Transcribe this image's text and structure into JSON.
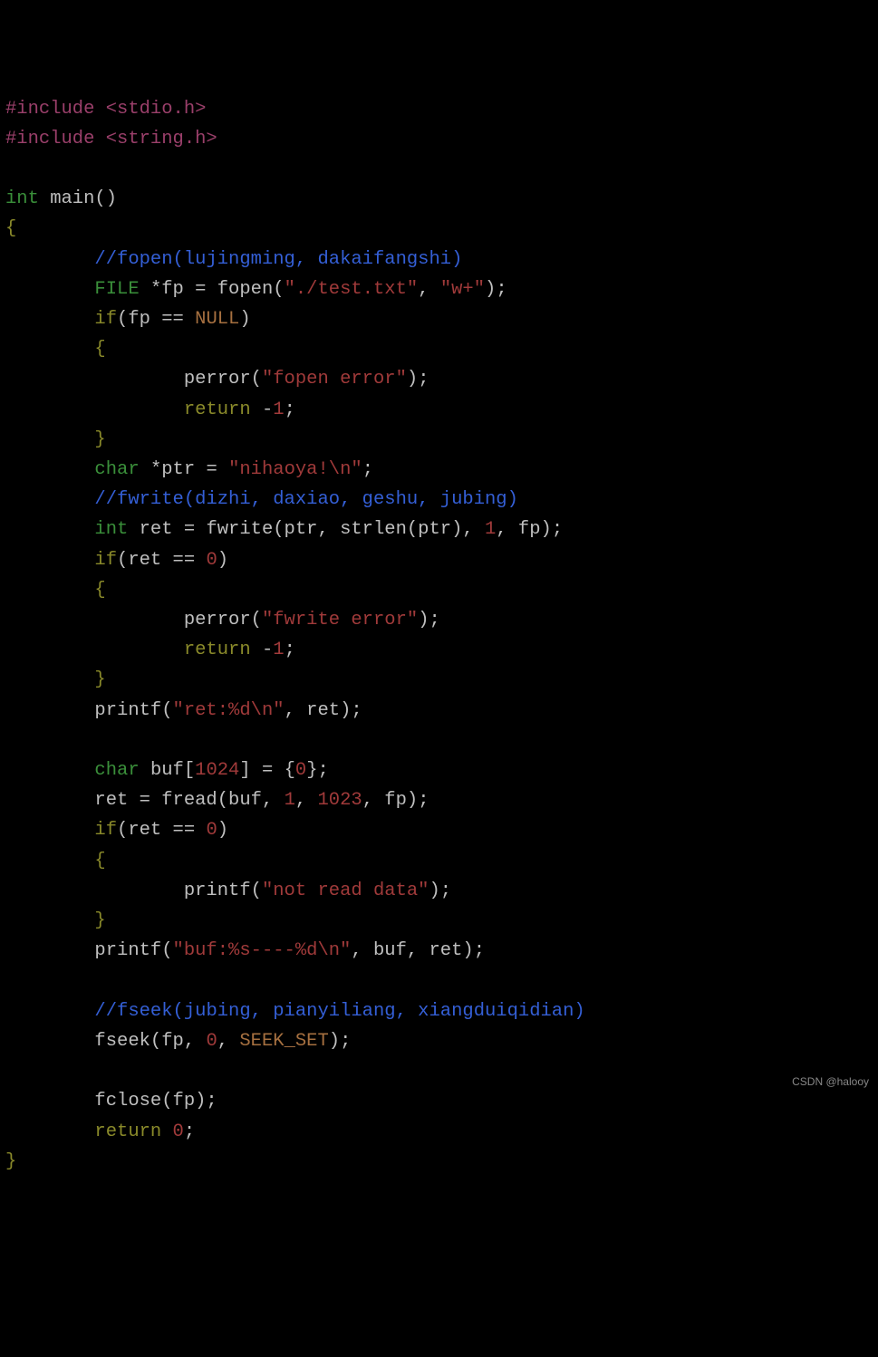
{
  "tokens": [
    [
      "pp",
      "#include "
    ],
    [
      "hdr",
      "<stdio.h>"
    ],
    [
      "nl",
      ""
    ],
    [
      "pp",
      "#include "
    ],
    [
      "hdr",
      "<string.h>"
    ],
    [
      "nl",
      ""
    ],
    [
      "nl",
      ""
    ],
    [
      "typ",
      "int"
    ],
    [
      "id",
      " main"
    ],
    [
      "op",
      "()"
    ],
    [
      "nl",
      ""
    ],
    [
      "br",
      "{"
    ],
    [
      "nl",
      ""
    ],
    [
      "id",
      "        "
    ],
    [
      "cmt",
      "//fopen(lujingming, dakaifangshi)"
    ],
    [
      "nl",
      ""
    ],
    [
      "id",
      "        "
    ],
    [
      "typ",
      "FILE"
    ],
    [
      "id",
      " *fp = fopen("
    ],
    [
      "str",
      "\"./test.txt\""
    ],
    [
      "id",
      ", "
    ],
    [
      "str",
      "\"w+\""
    ],
    [
      "id",
      ");"
    ],
    [
      "nl",
      ""
    ],
    [
      "id",
      "        "
    ],
    [
      "kw",
      "if"
    ],
    [
      "id",
      "(fp == "
    ],
    [
      "mac",
      "NULL"
    ],
    [
      "id",
      ")"
    ],
    [
      "nl",
      ""
    ],
    [
      "id",
      "        "
    ],
    [
      "br",
      "{"
    ],
    [
      "nl",
      ""
    ],
    [
      "id",
      "                perror("
    ],
    [
      "str",
      "\"fopen error\""
    ],
    [
      "id",
      ");"
    ],
    [
      "nl",
      ""
    ],
    [
      "id",
      "                "
    ],
    [
      "kw",
      "return"
    ],
    [
      "id",
      " -"
    ],
    [
      "num",
      "1"
    ],
    [
      "id",
      ";"
    ],
    [
      "nl",
      ""
    ],
    [
      "id",
      "        "
    ],
    [
      "br",
      "}"
    ],
    [
      "nl",
      ""
    ],
    [
      "id",
      "        "
    ],
    [
      "typ",
      "char"
    ],
    [
      "id",
      " *ptr = "
    ],
    [
      "str",
      "\"nihaoya!\\n\""
    ],
    [
      "id",
      ";"
    ],
    [
      "nl",
      ""
    ],
    [
      "id",
      "        "
    ],
    [
      "cmt",
      "//fwrite(dizhi, daxiao, geshu, jubing)"
    ],
    [
      "nl",
      ""
    ],
    [
      "id",
      "        "
    ],
    [
      "typ",
      "int"
    ],
    [
      "id",
      " ret = fwrite(ptr, strlen(ptr), "
    ],
    [
      "num",
      "1"
    ],
    [
      "id",
      ", fp);"
    ],
    [
      "nl",
      ""
    ],
    [
      "id",
      "        "
    ],
    [
      "kw",
      "if"
    ],
    [
      "id",
      "(ret == "
    ],
    [
      "num",
      "0"
    ],
    [
      "id",
      ")"
    ],
    [
      "nl",
      ""
    ],
    [
      "id",
      "        "
    ],
    [
      "br",
      "{"
    ],
    [
      "nl",
      ""
    ],
    [
      "id",
      "                perror("
    ],
    [
      "str",
      "\"fwrite error\""
    ],
    [
      "id",
      ");"
    ],
    [
      "nl",
      ""
    ],
    [
      "id",
      "                "
    ],
    [
      "kw",
      "return"
    ],
    [
      "id",
      " -"
    ],
    [
      "num",
      "1"
    ],
    [
      "id",
      ";"
    ],
    [
      "nl",
      ""
    ],
    [
      "id",
      "        "
    ],
    [
      "br",
      "}"
    ],
    [
      "nl",
      ""
    ],
    [
      "id",
      "        printf("
    ],
    [
      "str",
      "\"ret:%d\\n\""
    ],
    [
      "id",
      ", ret);"
    ],
    [
      "nl",
      ""
    ],
    [
      "nl",
      ""
    ],
    [
      "id",
      "        "
    ],
    [
      "typ",
      "char"
    ],
    [
      "id",
      " buf["
    ],
    [
      "num",
      "1024"
    ],
    [
      "id",
      "] = {"
    ],
    [
      "num",
      "0"
    ],
    [
      "id",
      "};"
    ],
    [
      "nl",
      ""
    ],
    [
      "id",
      "        ret = fread(buf, "
    ],
    [
      "num",
      "1"
    ],
    [
      "id",
      ", "
    ],
    [
      "num",
      "1023"
    ],
    [
      "id",
      ", fp);"
    ],
    [
      "nl",
      ""
    ],
    [
      "id",
      "        "
    ],
    [
      "kw",
      "if"
    ],
    [
      "id",
      "(ret == "
    ],
    [
      "num",
      "0"
    ],
    [
      "id",
      ")"
    ],
    [
      "nl",
      ""
    ],
    [
      "id",
      "        "
    ],
    [
      "br",
      "{"
    ],
    [
      "nl",
      ""
    ],
    [
      "id",
      "                printf("
    ],
    [
      "str",
      "\"not read data\""
    ],
    [
      "id",
      ");"
    ],
    [
      "nl",
      ""
    ],
    [
      "id",
      "        "
    ],
    [
      "br",
      "}"
    ],
    [
      "nl",
      ""
    ],
    [
      "id",
      "        printf("
    ],
    [
      "str",
      "\"buf:%s----%d\\n\""
    ],
    [
      "id",
      ", buf, ret);"
    ],
    [
      "nl",
      ""
    ],
    [
      "nl",
      ""
    ],
    [
      "id",
      "        "
    ],
    [
      "cmt",
      "//fseek(jubing, pianyiliang, xiangduiqidian)"
    ],
    [
      "nl",
      ""
    ],
    [
      "id",
      "        fseek(fp, "
    ],
    [
      "num",
      "0"
    ],
    [
      "id",
      ", "
    ],
    [
      "mac",
      "SEEK_SET"
    ],
    [
      "id",
      ");"
    ],
    [
      "nl",
      ""
    ],
    [
      "nl",
      ""
    ],
    [
      "id",
      "        fclose(fp);"
    ],
    [
      "nl",
      ""
    ],
    [
      "id",
      "        "
    ],
    [
      "kw",
      "return"
    ],
    [
      "id",
      " "
    ],
    [
      "num",
      "0"
    ],
    [
      "id",
      ";"
    ],
    [
      "nl",
      ""
    ],
    [
      "br",
      "}"
    ],
    [
      "nl",
      ""
    ]
  ],
  "watermark": "CSDN @halooy"
}
